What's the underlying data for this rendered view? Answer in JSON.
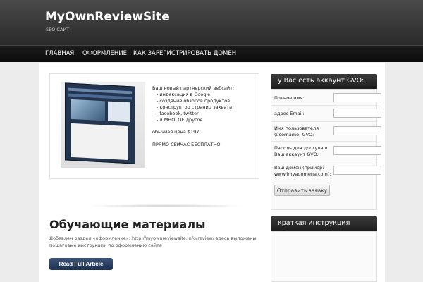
{
  "header": {
    "title": "MyOwnReviewSite",
    "tagline": "SEO САЙТ"
  },
  "nav": {
    "items": [
      "ГЛАВНАЯ",
      "ОФОРМЛЕНИЕ",
      "КАК ЗАРЕГИСТРИРОВАТЬ ДОМЕН"
    ]
  },
  "feature": {
    "lines": [
      "Ваш новый партнерский вебсайт:",
      "- индексация в Google",
      "- создание обзоров продуктов",
      "- конструктор страниц захвата",
      "- facebook, twitter",
      "- и МНОГОЕ другое",
      "обычная цена $197",
      "ПРЯМО СЕЙЧАС БЕСПЛАТНО"
    ]
  },
  "post": {
    "title": "Обучающие материалы",
    "excerpt_line1": "Добавлен раздел «оформление»: http://myownreviewsite.info/review/ здесь выложены",
    "excerpt_line2": "пошаговые инструкции по оформлению сайта",
    "read_more": "Read Full Article"
  },
  "sidebar": {
    "widget1_title": "у Вас есть аккаунт GVO:",
    "fields": [
      {
        "label_lines": [
          "Полное имя:"
        ]
      },
      {
        "label_lines": [
          "адрес Email:"
        ]
      },
      {
        "label_lines": [
          "Имя пользователя",
          "(username) GVO:"
        ]
      },
      {
        "label_lines": [
          "Пароль для доступа в",
          "Ваш аккаунт GVO:"
        ]
      },
      {
        "label_lines": [
          "Ваш домен (пример:",
          "www.imyadomena.com):"
        ]
      }
    ],
    "submit_label": "Отправить заявку",
    "widget2_title": "краткая инструкция"
  }
}
